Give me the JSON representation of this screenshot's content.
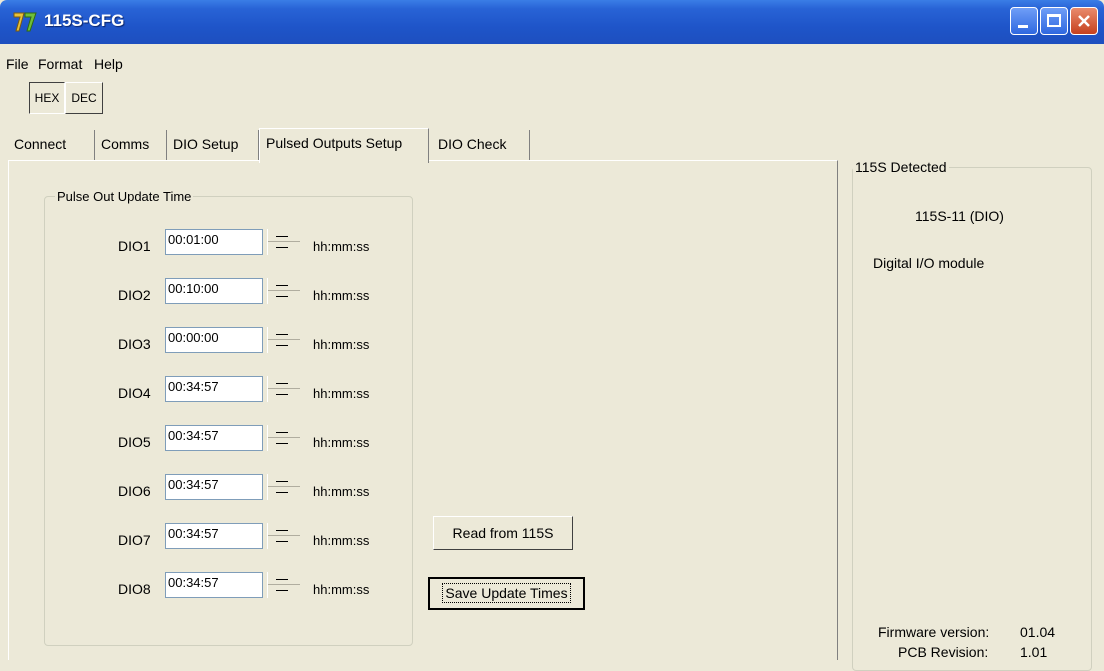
{
  "window": {
    "title": "115S-CFG"
  },
  "menu": [
    "File",
    "Format",
    "Help"
  ],
  "mode_buttons": {
    "hex": "HEX",
    "dec": "DEC"
  },
  "tabs": [
    "Connect",
    "Comms",
    "DIO Setup",
    "Pulsed Outputs Setup",
    "DIO Check"
  ],
  "active_tab": "Pulsed Outputs Setup",
  "pulse_group": {
    "title": "Pulse Out Update Time",
    "unit": "hh:mm:ss",
    "rows": [
      {
        "label": "DIO1",
        "value": "00:01:00"
      },
      {
        "label": "DIO2",
        "value": "00:10:00"
      },
      {
        "label": "DIO3",
        "value": "00:00:00"
      },
      {
        "label": "DIO4",
        "value": "00:34:57"
      },
      {
        "label": "DIO5",
        "value": "00:34:57"
      },
      {
        "label": "DIO6",
        "value": "00:34:57"
      },
      {
        "label": "DIO7",
        "value": "00:34:57"
      },
      {
        "label": "DIO8",
        "value": "00:34:57"
      }
    ]
  },
  "buttons": {
    "read": "Read from 115S",
    "save": "Save Update Times"
  },
  "detected": {
    "title": "115S Detected",
    "model": "115S-11 (DIO)",
    "description": "Digital I/O module",
    "firmware_label": "Firmware version:",
    "firmware_value": "01.04",
    "pcb_label": "PCB Revision:",
    "pcb_value": "1.01"
  }
}
